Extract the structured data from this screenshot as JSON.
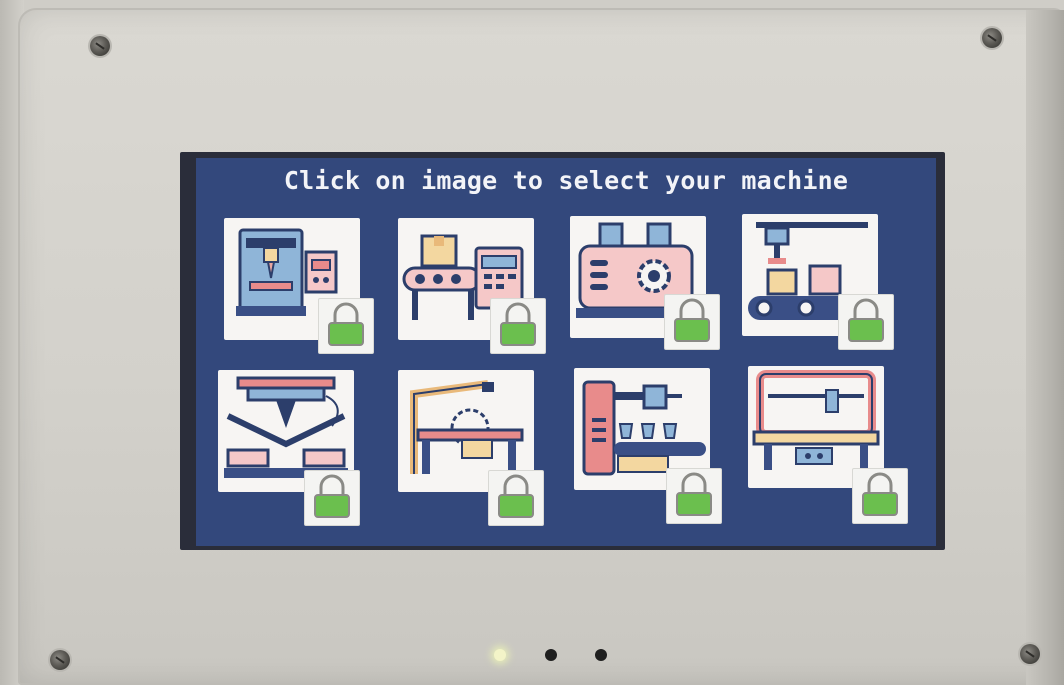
{
  "screen": {
    "title": "Click on image to select your machine",
    "background": "#33487c",
    "title_color": "#f3f4f8"
  },
  "machines": [
    {
      "icon": "cnc-milling-machine-icon",
      "locked": true
    },
    {
      "icon": "packaging-conveyor-machine-icon",
      "locked": true
    },
    {
      "icon": "mixing-processing-machine-icon",
      "locked": true
    },
    {
      "icon": "pick-and-place-conveyor-icon",
      "locked": true
    },
    {
      "icon": "press-brake-bending-machine-icon",
      "locked": true
    },
    {
      "icon": "table-saw-machine-icon",
      "locked": true
    },
    {
      "icon": "bottle-filling-machine-icon",
      "locked": true
    },
    {
      "icon": "cnc-router-machine-icon",
      "locked": true
    }
  ],
  "lock_icon": {
    "icon": "padlock-icon",
    "color": "#6bbf4e"
  },
  "pagination": {
    "pages": 3,
    "current": 1,
    "active_color": "#f3f4c8",
    "inactive_color": "#1f1f1f"
  }
}
